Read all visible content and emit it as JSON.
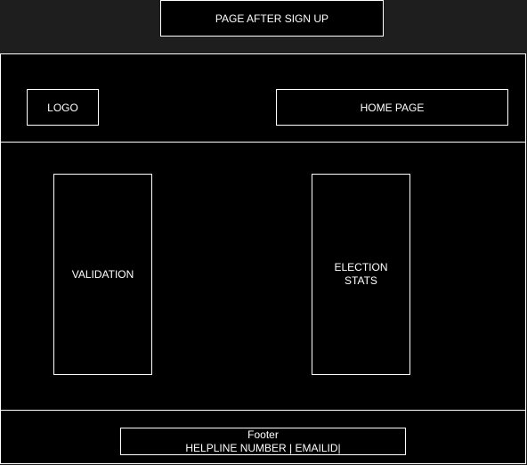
{
  "title": "PAGE AFTER SIGN UP",
  "header": {
    "logo": "LOGO",
    "home_page": "HOME PAGE"
  },
  "main": {
    "validation": "VALIDATION",
    "election_stats": [
      "ELECTION",
      "STATS"
    ]
  },
  "footer": {
    "label": "Footer",
    "contact": "HELPLINE NUMBER | EMAILID|"
  }
}
